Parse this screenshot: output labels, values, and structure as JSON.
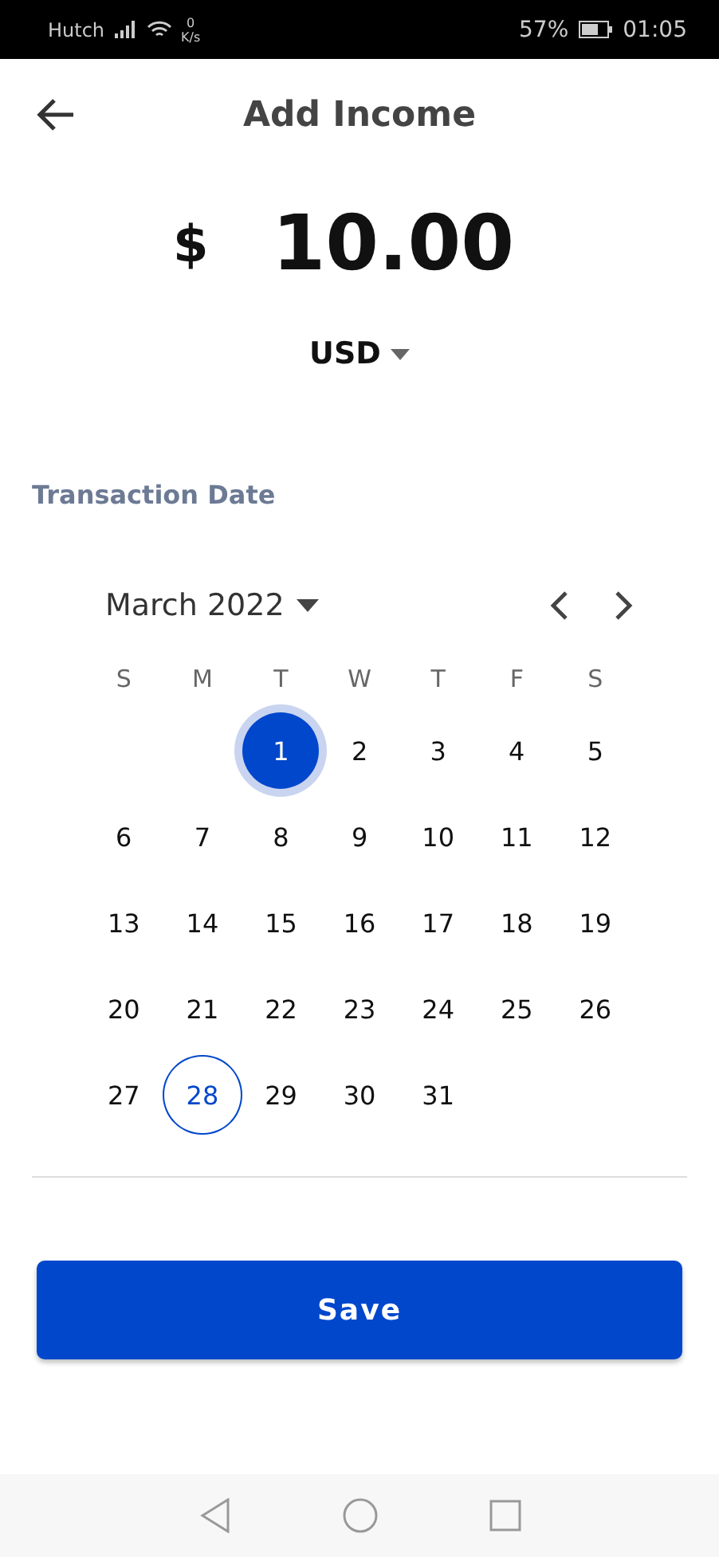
{
  "status_bar": {
    "carrier": "Hutch",
    "speed_value": "0",
    "speed_unit": "K/s",
    "battery": "57%",
    "time": "01:05"
  },
  "header": {
    "title": "Add Income"
  },
  "amount": {
    "symbol": "$",
    "value": "10.00"
  },
  "currency": {
    "code": "USD"
  },
  "date_label": "Transaction Date",
  "calendar": {
    "month": "March 2022",
    "weekdays": [
      "S",
      "M",
      "T",
      "W",
      "T",
      "F",
      "S"
    ],
    "weeks": [
      [
        {
          "day": "1",
          "selected": true,
          "today": false
        },
        {
          "day": "2",
          "selected": false,
          "today": false
        },
        {
          "day": "3",
          "selected": false,
          "today": false
        },
        {
          "day": "4",
          "selected": false,
          "today": false
        },
        {
          "day": "5",
          "selected": false,
          "today": false
        }
      ],
      [
        {
          "day": "6",
          "selected": false,
          "today": false
        },
        {
          "day": "7",
          "selected": false,
          "today": false
        },
        {
          "day": "8",
          "selected": false,
          "today": false
        },
        {
          "day": "9",
          "selected": false,
          "today": false
        },
        {
          "day": "10",
          "selected": false,
          "today": false
        },
        {
          "day": "11",
          "selected": false,
          "today": false
        },
        {
          "day": "12",
          "selected": false,
          "today": false
        }
      ],
      [
        {
          "day": "13",
          "selected": false,
          "today": false
        },
        {
          "day": "14",
          "selected": false,
          "today": false
        },
        {
          "day": "15",
          "selected": false,
          "today": false
        },
        {
          "day": "16",
          "selected": false,
          "today": false
        },
        {
          "day": "17",
          "selected": false,
          "today": false
        },
        {
          "day": "18",
          "selected": false,
          "today": false
        },
        {
          "day": "19",
          "selected": false,
          "today": false
        }
      ],
      [
        {
          "day": "20",
          "selected": false,
          "today": false
        },
        {
          "day": "21",
          "selected": false,
          "today": false
        },
        {
          "day": "22",
          "selected": false,
          "today": false
        },
        {
          "day": "23",
          "selected": false,
          "today": false
        },
        {
          "day": "24",
          "selected": false,
          "today": false
        },
        {
          "day": "25",
          "selected": false,
          "today": false
        },
        {
          "day": "26",
          "selected": false,
          "today": false
        }
      ],
      [
        {
          "day": "27",
          "selected": false,
          "today": false
        },
        {
          "day": "28",
          "selected": false,
          "today": true
        },
        {
          "day": "29",
          "selected": false,
          "today": false
        },
        {
          "day": "30",
          "selected": false,
          "today": false
        },
        {
          "day": "31",
          "selected": false,
          "today": false
        }
      ]
    ]
  },
  "save_button": "Save"
}
